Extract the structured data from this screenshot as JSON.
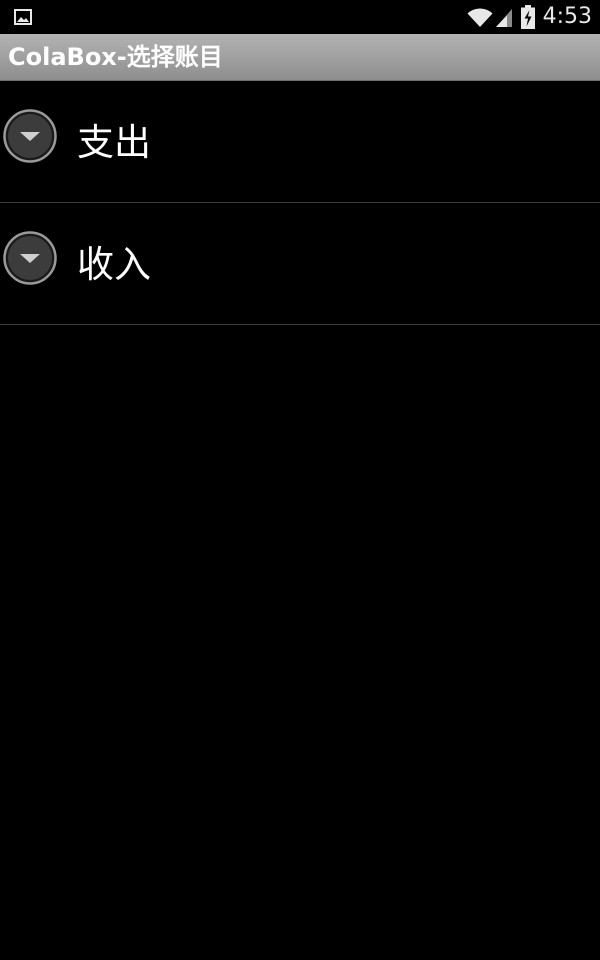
{
  "status_bar": {
    "left_icon": "gallery-notification-icon",
    "wifi_icon": "wifi-icon",
    "signal_icon": "cell-signal-icon",
    "battery_icon": "battery-charging-icon",
    "time": "4:53"
  },
  "title_bar": {
    "title": "ColaBox-选择账目"
  },
  "list": {
    "items": [
      {
        "label": "支出",
        "indicator": "chevron-down-icon"
      },
      {
        "label": "收入",
        "indicator": "chevron-down-icon"
      }
    ]
  }
}
